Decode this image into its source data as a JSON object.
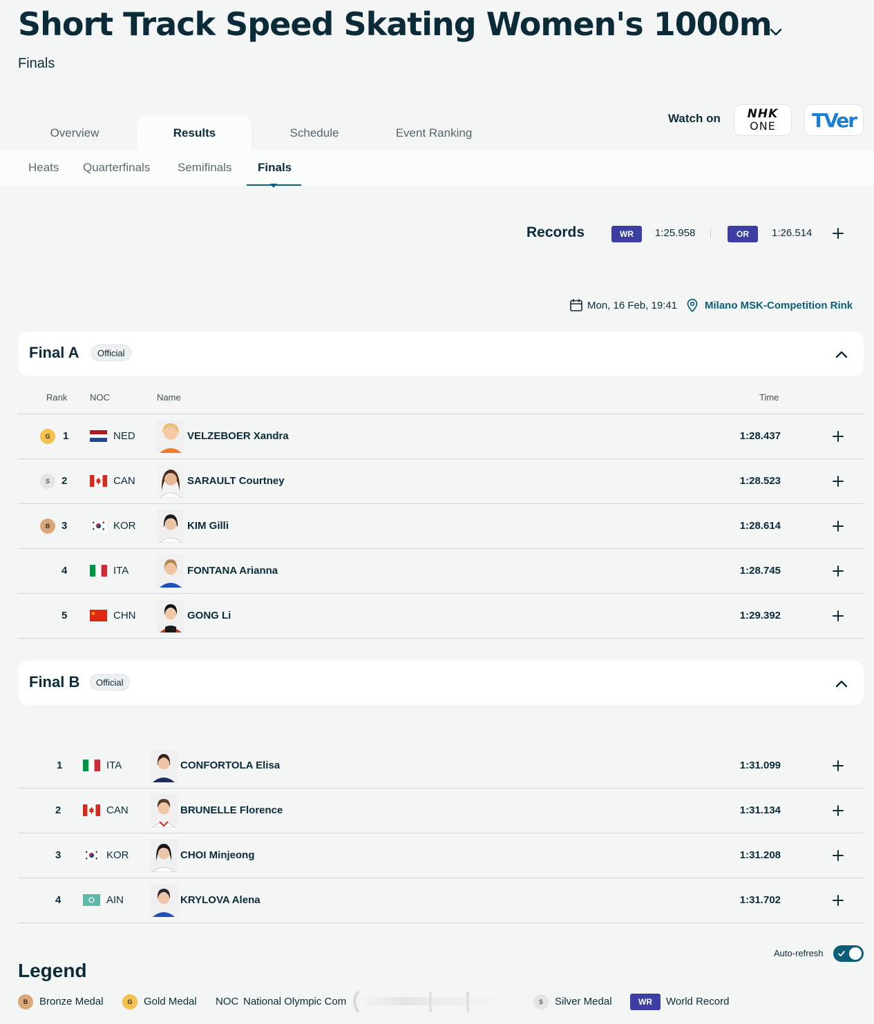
{
  "header": {
    "title": "Short Track Speed Skating Women's 1000m",
    "subtitle": "Finals"
  },
  "tabs": [
    {
      "label": "Overview",
      "active": false
    },
    {
      "label": "Results",
      "active": true
    },
    {
      "label": "Schedule",
      "active": false
    },
    {
      "label": "Event Ranking",
      "active": false
    }
  ],
  "subtabs": [
    {
      "label": "Heats",
      "active": false
    },
    {
      "label": "Quarterfinals",
      "active": false
    },
    {
      "label": "Semifinals",
      "active": false
    },
    {
      "label": "Finals",
      "active": true
    }
  ],
  "watch": {
    "label": "Watch on",
    "broadcasters": [
      {
        "line1": "NHK",
        "line2": "ONE"
      },
      {
        "name": "TVer"
      }
    ]
  },
  "records": {
    "label": "Records",
    "items": [
      {
        "code": "WR",
        "time": "1:25.958"
      },
      {
        "code": "OR",
        "time": "1:26.514"
      }
    ]
  },
  "event": {
    "date": "Mon, 16 Feb, 19:41",
    "venue": "Milano MSK-Competition Rink"
  },
  "columns": {
    "rank": "Rank",
    "noc": "NOC",
    "name": "Name",
    "time": "Time"
  },
  "finalA": {
    "title": "Final A",
    "status": "Official",
    "rows": [
      {
        "medal": "G",
        "rank": "1",
        "noc": "NED",
        "name": "VELZEBOER Xandra",
        "time": "1:28.437"
      },
      {
        "medal": "S",
        "rank": "2",
        "noc": "CAN",
        "name": "SARAULT Courtney",
        "time": "1:28.523"
      },
      {
        "medal": "B",
        "rank": "3",
        "noc": "KOR",
        "name": "KIM Gilli",
        "time": "1:28.614"
      },
      {
        "medal": "",
        "rank": "4",
        "noc": "ITA",
        "name": "FONTANA Arianna",
        "time": "1:28.745"
      },
      {
        "medal": "",
        "rank": "5",
        "noc": "CHN",
        "name": "GONG Li",
        "time": "1:29.392"
      }
    ]
  },
  "finalB": {
    "title": "Final B",
    "status": "Official",
    "rows": [
      {
        "rank": "1",
        "noc": "ITA",
        "name": "CONFORTOLA Elisa",
        "time": "1:31.099"
      },
      {
        "rank": "2",
        "noc": "CAN",
        "name": "BRUNELLE Florence",
        "time": "1:31.134"
      },
      {
        "rank": "3",
        "noc": "KOR",
        "name": "CHOI Minjeong",
        "time": "1:31.208"
      },
      {
        "rank": "4",
        "noc": "AIN",
        "name": "KRYLOVA Alena",
        "time": "1:31.702"
      }
    ]
  },
  "autorefresh": {
    "label": "Auto-refresh",
    "on": true
  },
  "legend": {
    "title": "Legend",
    "items": [
      {
        "badge": "B",
        "label": "Bronze Medal"
      },
      {
        "badge": "G",
        "label": "Gold Medal"
      },
      {
        "badge": "NOC",
        "label": "National Olympic Com"
      },
      {
        "badge": "S",
        "label": "Silver Medal"
      },
      {
        "badge": "WR",
        "label": "World Record"
      }
    ]
  },
  "colors": {
    "primary": "#0b2b38",
    "accent": "#0b5e76",
    "record_badge": "#3c3ea3",
    "gold": "#f2c14e",
    "silver": "#e2e4e5",
    "bronze": "#d9a77b"
  }
}
